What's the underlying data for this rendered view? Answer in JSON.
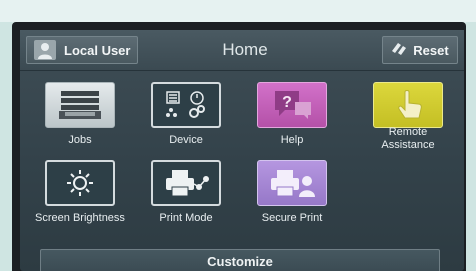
{
  "header": {
    "user_label": "Local User",
    "user_icon": "user-avatar-icon",
    "title": "Home",
    "reset_label": "Reset",
    "reset_icon": "eraser-icon"
  },
  "apps": [
    {
      "label": "Jobs",
      "icon": "jobs-stack-icon",
      "color": "#dde3e5"
    },
    {
      "label": "Device",
      "icon": "device-icon",
      "color": "#2d3f47"
    },
    {
      "label": "Help",
      "icon": "help-question-icon",
      "color": "#c562bb"
    },
    {
      "label": "Remote\nAssistance",
      "label_line1": "Remote",
      "label_line2": "Assistance",
      "icon": "hand-pointer-icon",
      "color": "#d4cf32"
    },
    {
      "label": "Screen Brightness",
      "icon": "brightness-icon",
      "color": "#2d3f47"
    },
    {
      "label": "Print Mode",
      "icon": "print-mode-icon",
      "color": "#2d3f47"
    },
    {
      "label": "Secure Print",
      "icon": "secure-print-icon",
      "color": "#a687d5"
    }
  ],
  "footer": {
    "customize_label": "Customize"
  }
}
